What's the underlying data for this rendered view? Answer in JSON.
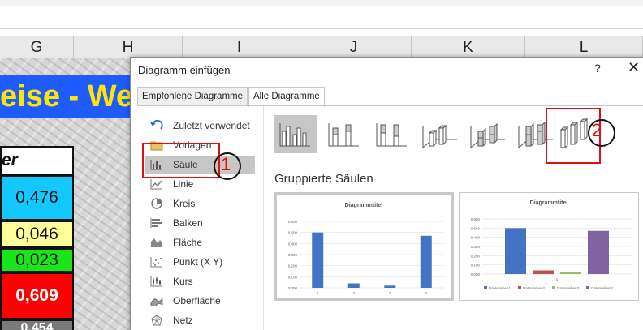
{
  "columns": [
    "G",
    "H",
    "I",
    "J",
    "K",
    "L"
  ],
  "sheet": {
    "banner_text": "eise - We",
    "cells": [
      "er",
      "0,476",
      "0,046",
      "0,023",
      "0,609",
      "0,454"
    ]
  },
  "dialog": {
    "title": "Diagramm einfügen",
    "help": "?",
    "close": "✕",
    "tabs": [
      "Empfohlene Diagramme",
      "Alle Diagramme"
    ],
    "nav_items": [
      {
        "label": "Zuletzt verwendet",
        "icon": "recent-icon"
      },
      {
        "label": "Vorlagen",
        "icon": "folder-icon"
      },
      {
        "label": "Säule",
        "icon": "column-chart-icon"
      },
      {
        "label": "Linie",
        "icon": "line-chart-icon"
      },
      {
        "label": "Kreis",
        "icon": "pie-chart-icon"
      },
      {
        "label": "Balken",
        "icon": "bar-chart-icon"
      },
      {
        "label": "Fläche",
        "icon": "area-chart-icon"
      },
      {
        "label": "Punkt (X Y)",
        "icon": "scatter-chart-icon"
      },
      {
        "label": "Kurs",
        "icon": "stock-chart-icon"
      },
      {
        "label": "Oberfläche",
        "icon": "surface-chart-icon"
      },
      {
        "label": "Netz",
        "icon": "radar-chart-icon"
      }
    ],
    "selected_nav": "Säule",
    "subtype_title": "Gruppierte Säulen",
    "previews": [
      {
        "title": "Diagrammtitel",
        "y_ticks": [
          "0,600",
          "0,500",
          "0,400",
          "0,300",
          "0,200",
          "0,100",
          "0,000"
        ],
        "x_labels": [
          "1",
          "2",
          "3",
          "4"
        ],
        "values": [
          0.5,
          0.04,
          0.02,
          0.47
        ]
      },
      {
        "title": "Diagrammtitel",
        "y_ticks": [
          "0,600",
          "0,500",
          "0,400",
          "0,300",
          "0,200",
          "0,100",
          "0,000"
        ],
        "x_labels": [
          "1"
        ],
        "values": [
          0.5,
          0.04,
          0.02,
          0.47
        ],
        "legend": [
          "Datenreihen1",
          "Datenreihen2",
          "Datenreihen3",
          "Datenreihen4"
        ]
      }
    ]
  },
  "annotations": [
    "1",
    "2"
  ],
  "colors": {
    "accent": "#4472c4",
    "series": [
      "#4472c4",
      "#c0504d",
      "#9bbb59",
      "#8064a2"
    ],
    "annotation": "#e01010"
  }
}
